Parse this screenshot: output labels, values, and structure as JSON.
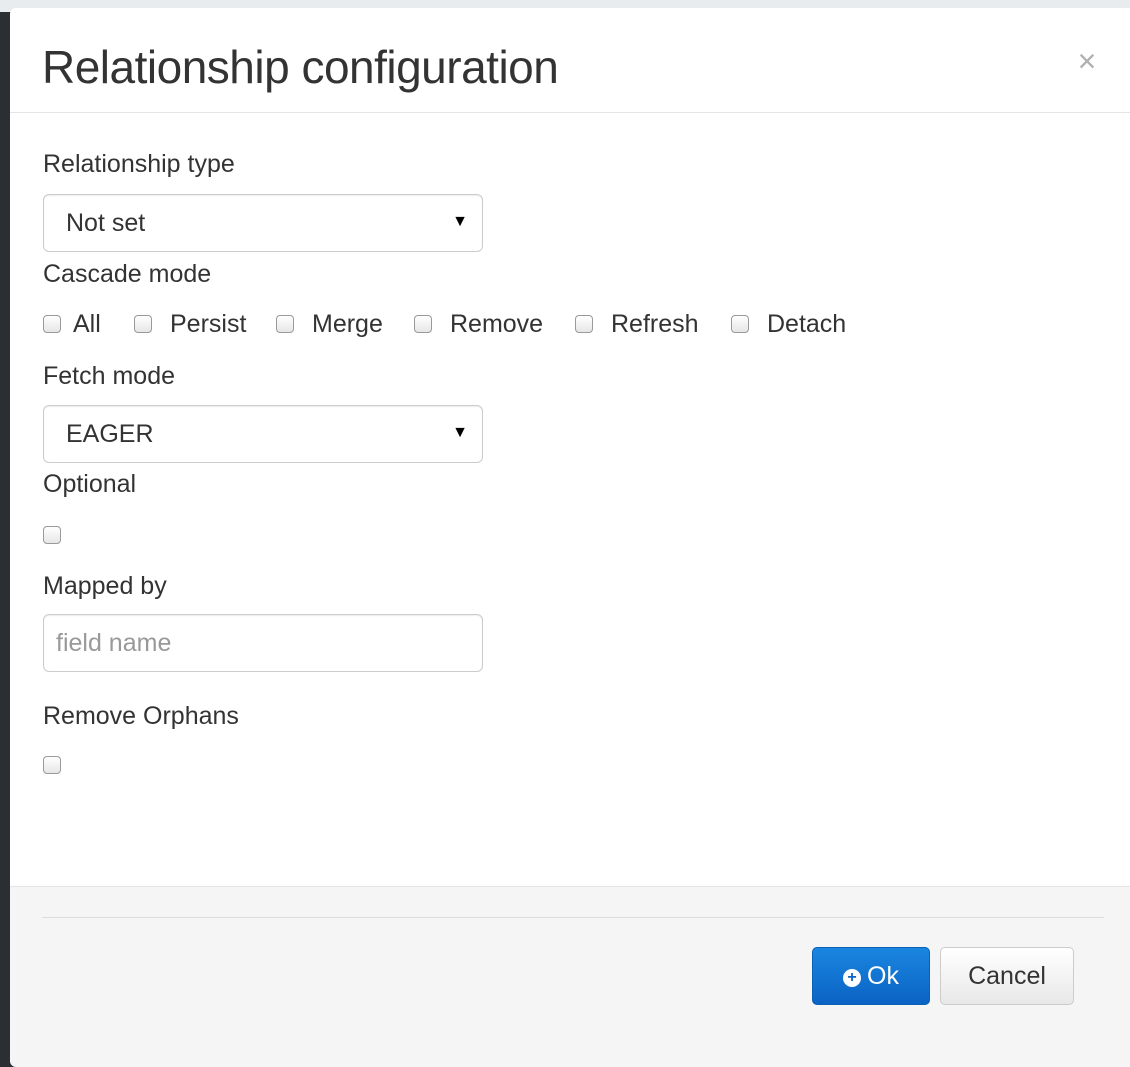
{
  "dialog": {
    "title": "Relationship configuration",
    "close_glyph": "×"
  },
  "relationship_type": {
    "label": "Relationship type",
    "selected": "Not set"
  },
  "cascade_mode": {
    "label": "Cascade mode",
    "options": [
      "All",
      "Persist",
      "Merge",
      "Remove",
      "Refresh",
      "Detach"
    ]
  },
  "fetch_mode": {
    "label": "Fetch mode",
    "selected": "EAGER"
  },
  "optional": {
    "label": "Optional"
  },
  "mapped_by": {
    "label": "Mapped by",
    "placeholder": "field name",
    "value": ""
  },
  "remove_orphans": {
    "label": "Remove Orphans"
  },
  "footer": {
    "ok_label": "Ok",
    "cancel_label": "Cancel"
  },
  "colors": {
    "primary": "#0b63c4",
    "footer_bg": "#f5f5f5"
  },
  "icons": {
    "ok": "plus-circle-icon",
    "close": "close-icon",
    "select_caret": "caret-down-icon"
  }
}
